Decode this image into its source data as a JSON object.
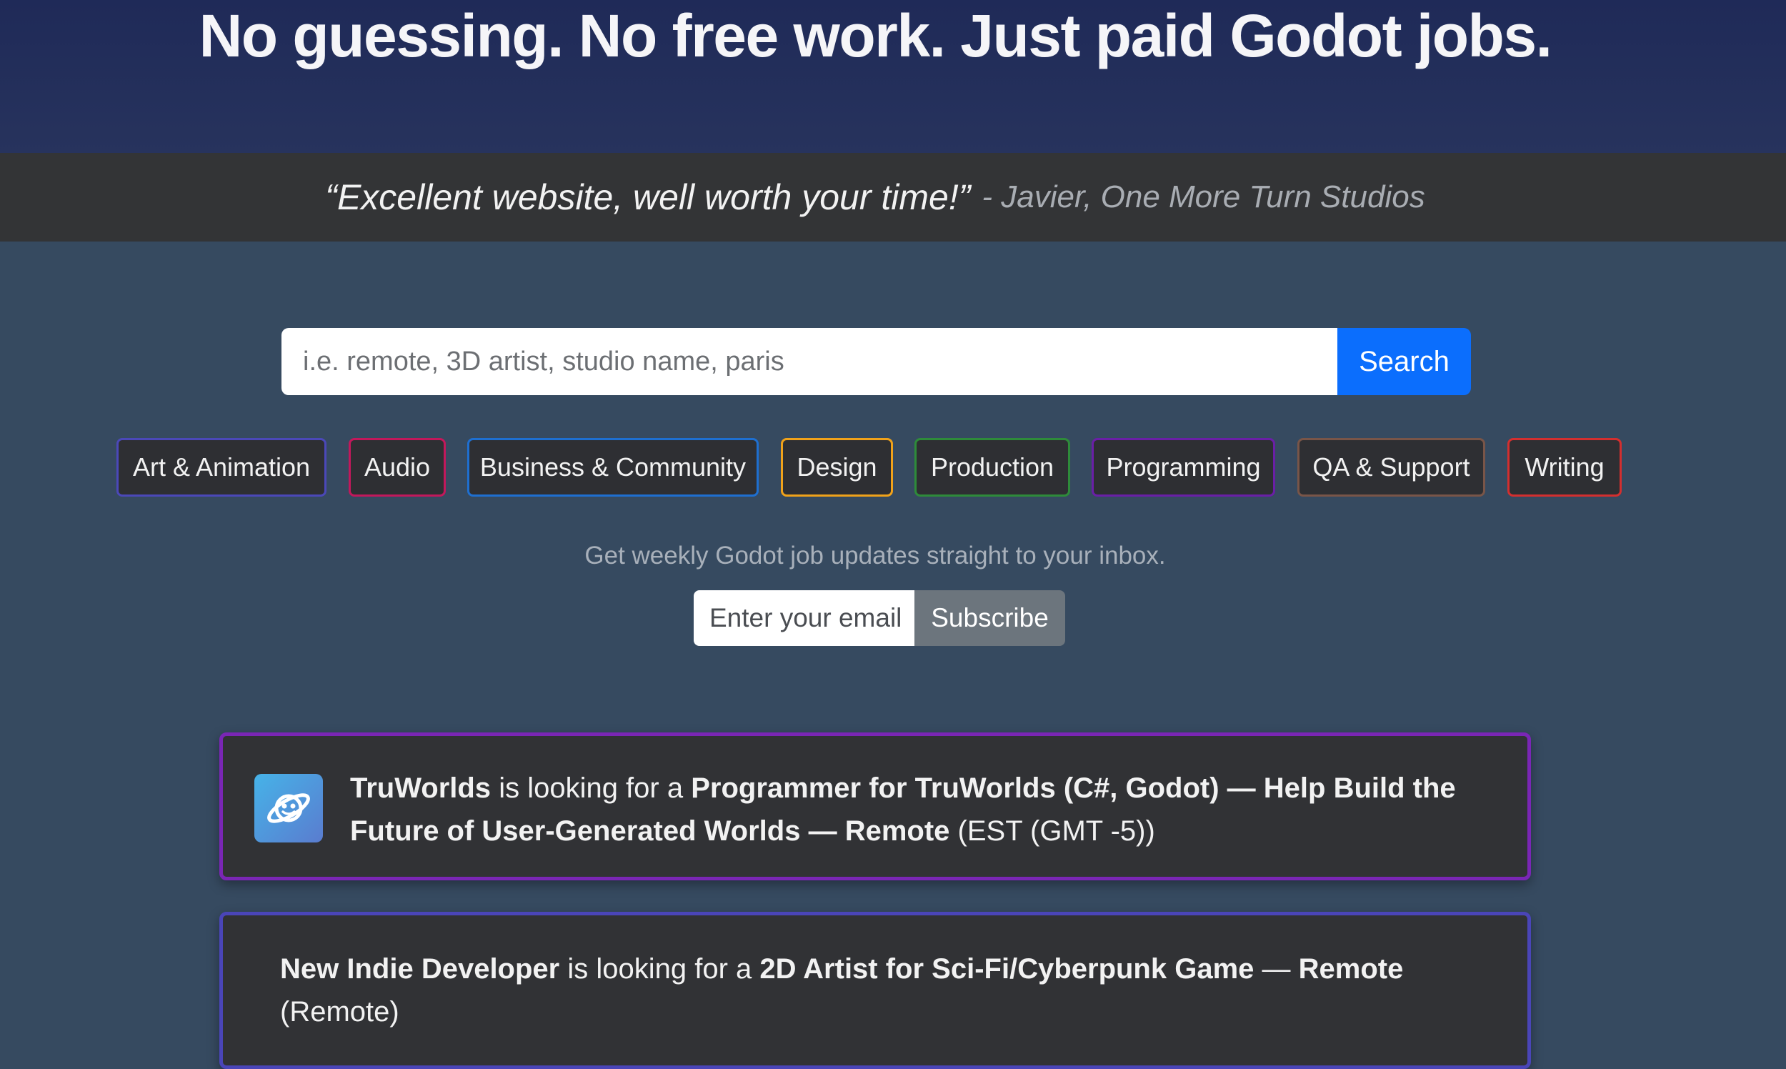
{
  "hero": {
    "headline": "No guessing. No free work. Just paid Godot jobs."
  },
  "testimonial": {
    "quote": "“Excellent website, well worth your time!”",
    "author": "- Javier, One More Turn Studios"
  },
  "search": {
    "placeholder": "i.e. remote, 3D artist, studio name, paris",
    "button_label": "Search"
  },
  "categories": [
    {
      "label": "Art & Animation",
      "color": "#4b48b8"
    },
    {
      "label": "Audio",
      "color": "#c2185b"
    },
    {
      "label": "Business & Community",
      "color": "#1e6fd0"
    },
    {
      "label": "Design",
      "color": "#f0a21a"
    },
    {
      "label": "Production",
      "color": "#2e8b3a"
    },
    {
      "label": "Programming",
      "color": "#6a1fa6"
    },
    {
      "label": "QA & Support",
      "color": "#795548"
    },
    {
      "label": "Writing",
      "color": "#d32f2f"
    }
  ],
  "newsletter": {
    "text": "Get weekly Godot job updates straight to your inbox.",
    "placeholder": "Enter your email",
    "button_label": "Subscribe"
  },
  "jobs": [
    {
      "company": "TruWorlds",
      "connector": "is looking for a",
      "title": "Programmer for TruWorlds (C#, Godot) — Help Build the Future of User-Generated Worlds — Remote",
      "location": "(EST (GMT -5))",
      "logo_icon": "planet-icon",
      "border_color": "#7a26b5"
    },
    {
      "company": "New Indie Developer",
      "connector": "is looking for a",
      "title_pre": "2D Artist for Sci-Fi/Cyberpunk Game",
      "dash": "—",
      "title_post": "Remote",
      "location": "(Remote)",
      "border_color": "#4a45b8"
    }
  ]
}
